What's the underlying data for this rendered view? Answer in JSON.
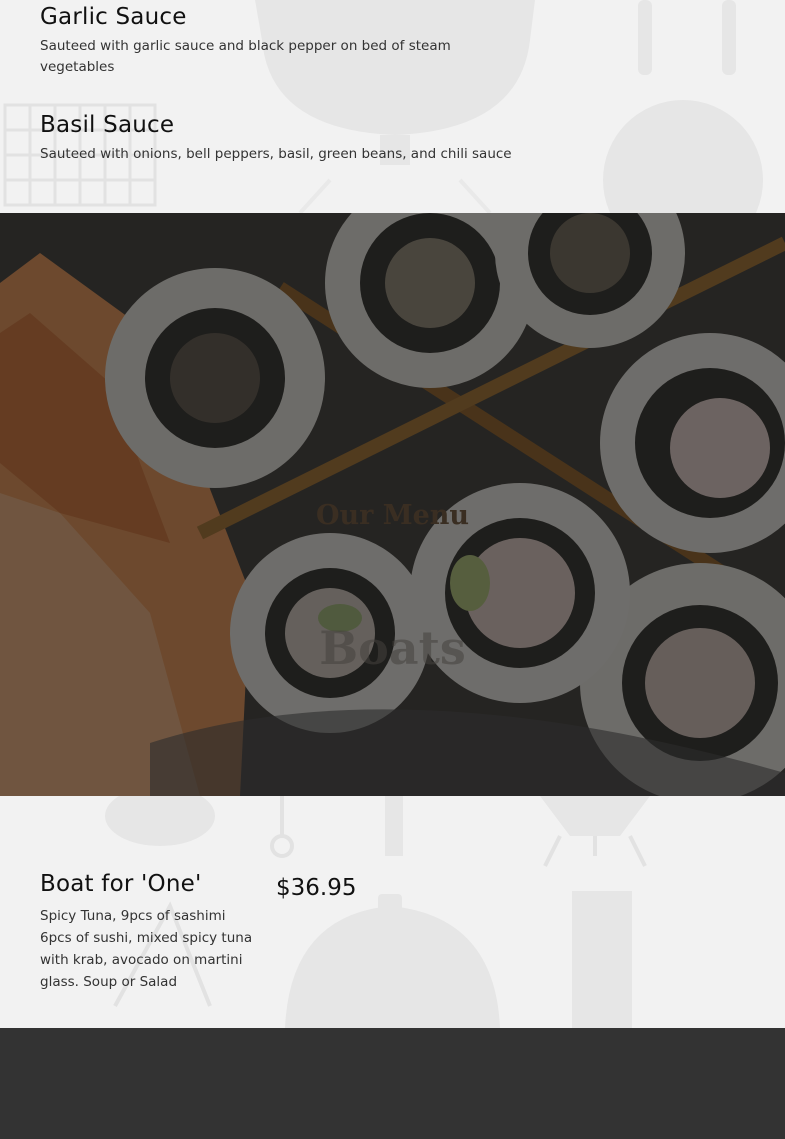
{
  "sauces": [
    {
      "title": "Garlic Sauce",
      "description": "Sauteed with garlic sauce and black pepper on bed of steam vegetables"
    },
    {
      "title": "Basil Sauce",
      "description": "Sauteed with onions, bell peppers, basil, green beans, and chili sauce"
    }
  ],
  "banner": {
    "title": "Our Menu",
    "subtitle": "Boats"
  },
  "menu_items": [
    {
      "title": "Boat for 'One'",
      "price": "$36.95",
      "description": "Spicy Tuna, 9pcs of sashimi 6pcs of sushi, mixed spicy tuna with krab, avocado on martini glass. Soup or Salad"
    }
  ],
  "colors": {
    "page_background": "#f2f2f2",
    "footer_background": "#333333",
    "banner_title": "#3a2e22"
  }
}
